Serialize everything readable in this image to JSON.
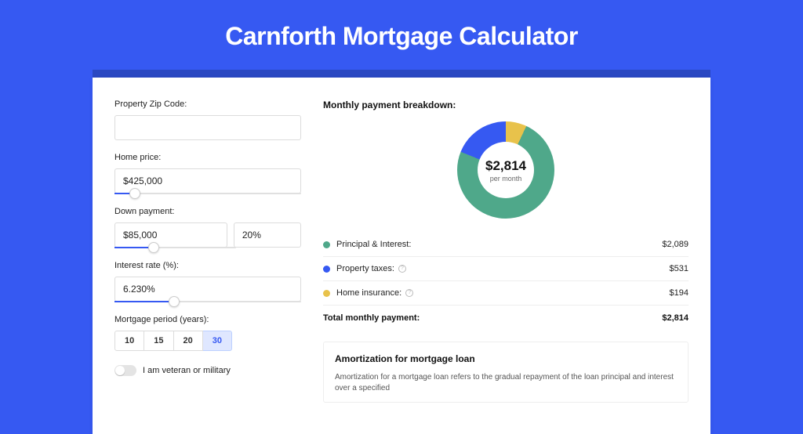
{
  "title": "Carnforth Mortgage Calculator",
  "form": {
    "zip_label": "Property Zip Code:",
    "zip_value": "",
    "home_price_label": "Home price:",
    "home_price_value": "$425,000",
    "down_payment_label": "Down payment:",
    "down_payment_value": "$85,000",
    "down_payment_pct": "20%",
    "interest_label": "Interest rate (%):",
    "interest_value": "6.230%",
    "period_label": "Mortgage period (years):",
    "period_options": [
      "10",
      "15",
      "20",
      "30"
    ],
    "period_selected": "30",
    "veteran_label": "I am veteran or military"
  },
  "breakdown": {
    "title": "Monthly payment breakdown:",
    "center_amount": "$2,814",
    "center_sub": "per month",
    "items": [
      {
        "label": "Principal & Interest:",
        "value": "$2,089",
        "color": "#4fa88a",
        "info": false
      },
      {
        "label": "Property taxes:",
        "value": "$531",
        "color": "#3659f2",
        "info": true
      },
      {
        "label": "Home insurance:",
        "value": "$194",
        "color": "#e8c24b",
        "info": true
      }
    ],
    "total_label": "Total monthly payment:",
    "total_value": "$2,814"
  },
  "chart_data": {
    "type": "pie",
    "title": "Monthly payment breakdown",
    "series": [
      {
        "name": "Principal & Interest",
        "value": 2089,
        "color": "#4fa88a"
      },
      {
        "name": "Property taxes",
        "value": 531,
        "color": "#3659f2"
      },
      {
        "name": "Home insurance",
        "value": 194,
        "color": "#e8c24b"
      }
    ],
    "total": 2814,
    "unit": "USD/month"
  },
  "amortization": {
    "title": "Amortization for mortgage loan",
    "text": "Amortization for a mortgage loan refers to the gradual repayment of the loan principal and interest over a specified"
  }
}
